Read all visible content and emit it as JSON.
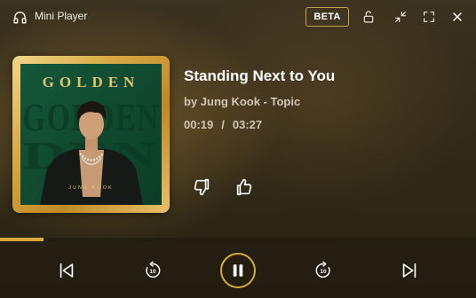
{
  "window": {
    "app_title": "Mini Player",
    "badge": "BETA",
    "icons": [
      "headphones-icon",
      "lock-icon",
      "minimize-icon",
      "fullscreen-icon",
      "close-icon"
    ]
  },
  "album": {
    "cover_title": "GOLDEN",
    "cover_background_text": "GOLDEN",
    "cover_artist": "JUNG KOOK"
  },
  "track": {
    "title": "Standing Next to You",
    "artist": "by Jung Kook - Topic",
    "current_time": "00:19",
    "separator": "/",
    "duration": "03:27"
  },
  "progress": {
    "fraction": 0.092
  },
  "controls": {
    "skip_back_seconds": "10",
    "skip_forward_seconds": "10",
    "icons": [
      "previous-icon",
      "rewind-10-icon",
      "pause-icon",
      "forward-10-icon",
      "next-icon"
    ]
  },
  "colors": {
    "accent": "#d9a93e",
    "text_secondary": "#cfc7b6",
    "cover_green": "#11502f"
  }
}
